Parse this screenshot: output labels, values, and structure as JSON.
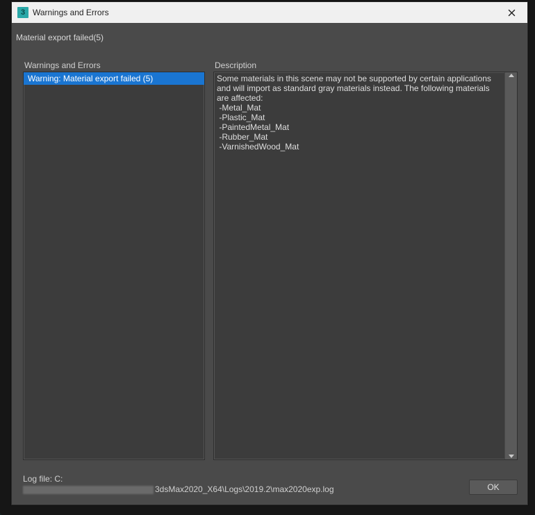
{
  "titlebar": {
    "app_icon_glyph": "3",
    "title": "Warnings and Errors"
  },
  "summary": "Material export failed(5)",
  "left_panel": {
    "label": "Warnings and Errors",
    "items": [
      {
        "text": "Warning: Material export failed (5)",
        "selected": true
      }
    ]
  },
  "right_panel": {
    "label": "Description",
    "intro": "Some materials in this scene may not be supported by certain applications and will import as standard gray materials instead. The following materials are affected:",
    "materials": [
      "Metal_Mat",
      "Plastic_Mat",
      "PaintedMetal_Mat",
      "Rubber_Mat",
      "VarnishedWood_Mat"
    ]
  },
  "footer": {
    "log_prefix": "Log file: C:",
    "log_suffix": "3dsMax2020_X64\\Logs\\2019.2\\max2020exp.log",
    "ok_label": "OK"
  }
}
